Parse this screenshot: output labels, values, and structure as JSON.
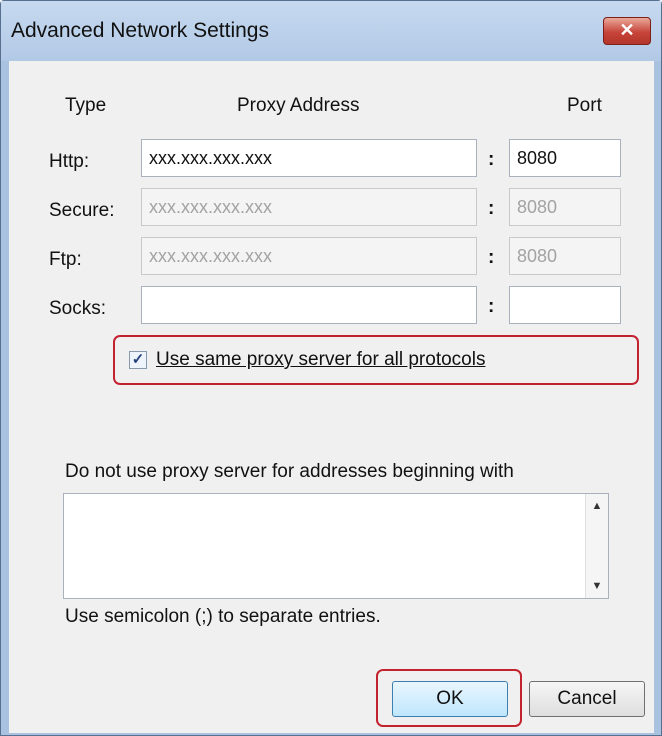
{
  "window": {
    "title": "Advanced Network Settings",
    "close_glyph": "✕"
  },
  "headers": {
    "type": "Type",
    "address": "Proxy Address",
    "port": "Port"
  },
  "rows": [
    {
      "label": "Http:",
      "address": "xxx.xxx.xxx.xxx",
      "port": "8080",
      "enabled": true
    },
    {
      "label": "Secure:",
      "address": "xxx.xxx.xxx.xxx",
      "port": "8080",
      "enabled": false
    },
    {
      "label": "Ftp:",
      "address": "xxx.xxx.xxx.xxx",
      "port": "8080",
      "enabled": false
    },
    {
      "label": "Socks:",
      "address": "",
      "port": "",
      "enabled": true
    }
  ],
  "separator": ":",
  "same_proxy": {
    "label": "Use same proxy server for all protocols",
    "checked": true,
    "check_glyph": "✓"
  },
  "bypass": {
    "label": "Do not use proxy server for addresses beginning with",
    "value": "",
    "hint": "Use semicolon (;) to separate entries."
  },
  "scroll": {
    "up_glyph": "▲",
    "down_glyph": "▼"
  },
  "buttons": {
    "ok": "OK",
    "cancel": "Cancel"
  },
  "colors": {
    "highlight": "#c3232e",
    "close": "#c7443a",
    "titlebar": "#b2c9e6"
  }
}
